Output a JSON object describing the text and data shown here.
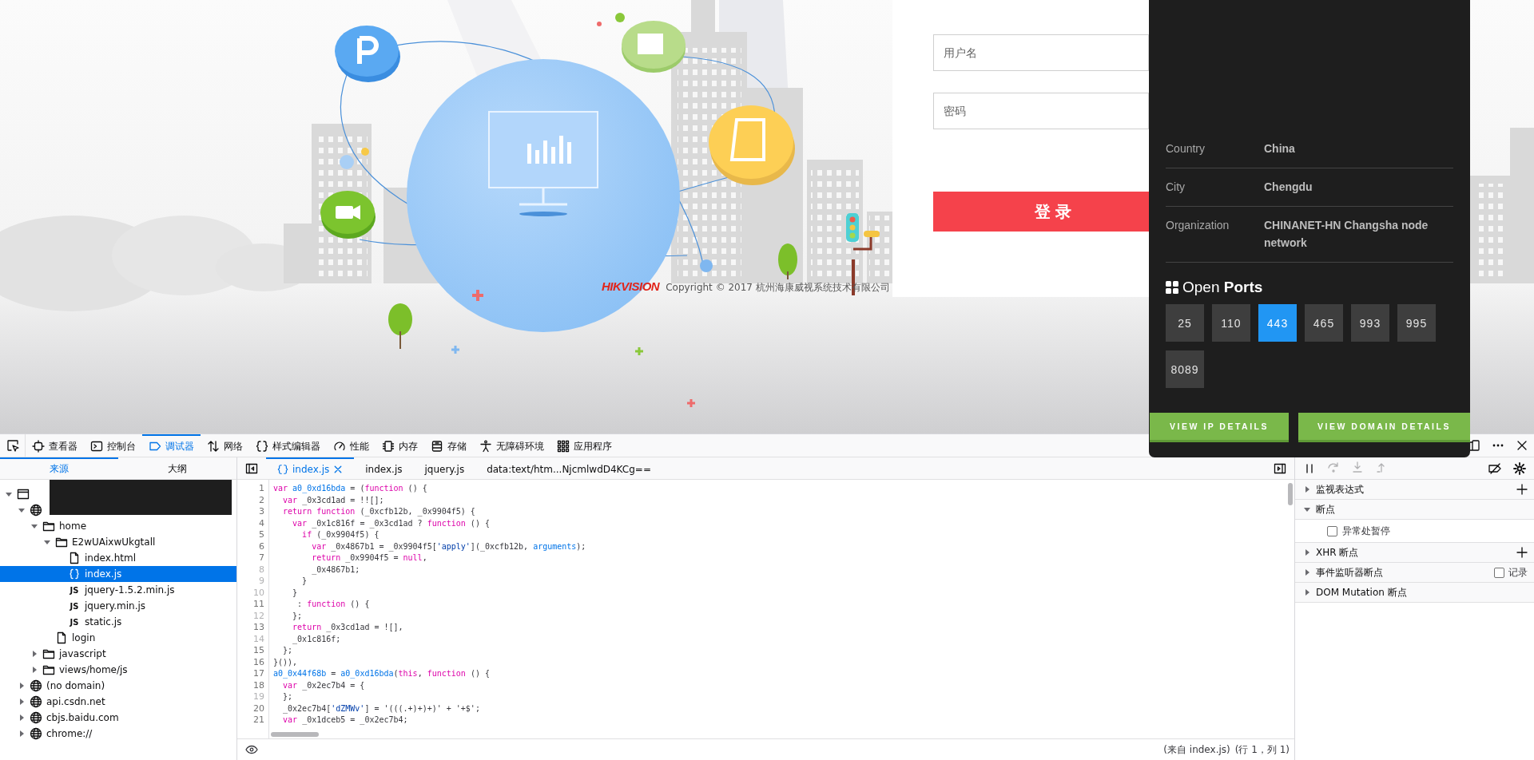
{
  "web_page": {
    "logo": "HIKVISION",
    "copyright": "Copyright © 2017 杭州海康威视系统技术有限公司",
    "login": {
      "username": {
        "placeholder": "用户名"
      },
      "password": {
        "placeholder": "密码"
      },
      "button": "登 录"
    }
  },
  "ip_popup": {
    "details": [
      {
        "label": "Country",
        "value": "China"
      },
      {
        "label": "City",
        "value": "Chengdu"
      },
      {
        "label": "Organization",
        "value": "CHINANET-HN Changsha node network"
      }
    ],
    "ports_title": "Open **Ports**",
    "ports": [
      {
        "label": "25",
        "selected": false
      },
      {
        "label": "110",
        "selected": false
      },
      {
        "label": "443",
        "selected": true
      },
      {
        "label": "465",
        "selected": false
      },
      {
        "label": "993",
        "selected": false
      },
      {
        "label": "995",
        "selected": false
      },
      {
        "label": "8089",
        "selected": false
      }
    ],
    "buttons": [
      "VIEW IP DETAILS",
      "VIEW DOMAIN DETAILS"
    ]
  },
  "devtools": {
    "tabs": [
      {
        "label": "查看器",
        "selected": false
      },
      {
        "label": "控制台",
        "selected": false
      },
      {
        "label": "调试器",
        "selected": true
      },
      {
        "label": "网络",
        "selected": false
      },
      {
        "label": "样式编辑器",
        "selected": false
      },
      {
        "label": "性能",
        "selected": false
      },
      {
        "label": "内存",
        "selected": false
      },
      {
        "label": "存储",
        "selected": false
      },
      {
        "label": "无障碍环境",
        "selected": false
      },
      {
        "label": "应用程序",
        "selected": false
      }
    ],
    "source_tabs": [
      {
        "label": "来源",
        "selected": true
      },
      {
        "label": "大纲",
        "selected": false
      }
    ],
    "tree": [
      {
        "kind": "window",
        "expanded": true,
        "selected": false,
        "children": [
          {
            "kind": "globe",
            "expanded": true,
            "selected": false,
            "children": [
              {
                "kind": "folder",
                "label": "home",
                "expanded": true,
                "selected": false,
                "children": [
                  {
                    "kind": "folder",
                    "label": "E2wUAixwUkgtall",
                    "expanded": true,
                    "selected": false,
                    "children": [
                      {
                        "kind": "file",
                        "label": "index.html",
                        "selected": false
                      },
                      {
                        "kind": "braces",
                        "label": "index.js",
                        "selected": true
                      },
                      {
                        "kind": "js",
                        "badge": "JS",
                        "label": "jquery-1.5.2.min.js",
                        "selected": false
                      },
                      {
                        "kind": "js",
                        "badge": "JS",
                        "label": "jquery.min.js",
                        "selected": false
                      },
                      {
                        "kind": "js",
                        "badge": "JS",
                        "label": "static.js",
                        "selected": false
                      }
                    ]
                  },
                  {
                    "kind": "file",
                    "label": "login",
                    "selected": false
                  }
                ]
              },
              {
                "kind": "folder",
                "label": "javascript",
                "expanded": false,
                "selected": false
              },
              {
                "kind": "folder",
                "label": "views/home/js",
                "expanded": false,
                "selected": false
              }
            ]
          },
          {
            "kind": "globe",
            "label": "(no domain)",
            "expanded": false,
            "selected": false
          },
          {
            "kind": "globe",
            "label": "api.csdn.net",
            "expanded": false,
            "selected": false
          },
          {
            "kind": "globe",
            "label": "cbjs.baidu.com",
            "expanded": false,
            "selected": false
          },
          {
            "kind": "globe",
            "label": "chrome://",
            "expanded": false,
            "selected": false
          }
        ]
      }
    ],
    "editor_tabs": [
      {
        "label": "index.js",
        "selected": true,
        "closable": true
      },
      {
        "label": "index.js",
        "selected": false,
        "closable": false
      },
      {
        "label": "jquery.js",
        "selected": false,
        "closable": false
      },
      {
        "label": "data:text/htm...NjcmlwdD4KCg==",
        "selected": false,
        "closable": false
      }
    ],
    "code_lines": [
      {
        "number": "1",
        "breakable": true,
        "tokens": [
          {
            "kind": "kw",
            "text": "var "
          },
          {
            "kind": "def",
            "text": "a0_0xd16bda"
          },
          {
            "kind": "plain",
            "text": " = ("
          },
          {
            "kind": "kw",
            "text": "function"
          },
          {
            "kind": "plain",
            "text": " () {"
          }
        ]
      },
      {
        "number": "2",
        "breakable": true,
        "tokens": [
          {
            "kind": "kw",
            "text": "  var "
          },
          {
            "kind": "plain",
            "text": "_0x3cd1ad = !![];"
          }
        ]
      },
      {
        "number": "3",
        "breakable": true,
        "tokens": [
          {
            "kind": "kw",
            "text": "  return function "
          },
          {
            "kind": "plain",
            "text": "(_0xcfb12b, _0x9904f5) {"
          }
        ]
      },
      {
        "number": "4",
        "breakable": true,
        "tokens": [
          {
            "kind": "kw",
            "text": "    var "
          },
          {
            "kind": "plain",
            "text": "_0x1c816f = _0x3cd1ad ? "
          },
          {
            "kind": "kw",
            "text": "function"
          },
          {
            "kind": "plain",
            "text": " () {"
          }
        ]
      },
      {
        "number": "5",
        "breakable": true,
        "tokens": [
          {
            "kind": "kw",
            "text": "      if "
          },
          {
            "kind": "plain",
            "text": "(_0x9904f5) {"
          }
        ]
      },
      {
        "number": "6",
        "breakable": true,
        "tokens": [
          {
            "kind": "kw",
            "text": "        var "
          },
          {
            "kind": "plain",
            "text": "_0x4867b1 = _0x9904f5["
          },
          {
            "kind": "str",
            "text": "'apply'"
          },
          {
            "kind": "plain",
            "text": "](_0xcfb12b, "
          },
          {
            "kind": "def",
            "text": "arguments"
          },
          {
            "kind": "plain",
            "text": ");"
          }
        ]
      },
      {
        "number": "7",
        "breakable": true,
        "tokens": [
          {
            "kind": "kw",
            "text": "        return "
          },
          {
            "kind": "plain",
            "text": "_0x9904f5 = "
          },
          {
            "kind": "kw",
            "text": "null"
          },
          {
            "kind": "plain",
            "text": ","
          }
        ]
      },
      {
        "number": "8",
        "breakable": false,
        "tokens": [
          {
            "kind": "plain",
            "text": "        _0x4867b1;"
          }
        ]
      },
      {
        "number": "9",
        "breakable": false,
        "tokens": [
          {
            "kind": "plain",
            "text": "      }"
          }
        ]
      },
      {
        "number": "10",
        "breakable": false,
        "tokens": [
          {
            "kind": "plain",
            "text": "    }"
          }
        ]
      },
      {
        "number": "11",
        "breakable": true,
        "tokens": [
          {
            "kind": "plain",
            "text": "     : "
          },
          {
            "kind": "kw",
            "text": "function"
          },
          {
            "kind": "plain",
            "text": " () {"
          }
        ]
      },
      {
        "number": "12",
        "breakable": false,
        "tokens": [
          {
            "kind": "plain",
            "text": "    };"
          }
        ]
      },
      {
        "number": "13",
        "breakable": true,
        "tokens": [
          {
            "kind": "kw",
            "text": "    return "
          },
          {
            "kind": "plain",
            "text": "_0x3cd1ad = ![],"
          }
        ]
      },
      {
        "number": "14",
        "breakable": false,
        "tokens": [
          {
            "kind": "plain",
            "text": "    _0x1c816f;"
          }
        ]
      },
      {
        "number": "15",
        "breakable": true,
        "tokens": [
          {
            "kind": "plain",
            "text": "  };"
          }
        ]
      },
      {
        "number": "16",
        "breakable": true,
        "tokens": [
          {
            "kind": "plain",
            "text": "}()),"
          }
        ]
      },
      {
        "number": "17",
        "breakable": true,
        "tokens": [
          {
            "kind": "def",
            "text": "a0_0x44f68b"
          },
          {
            "kind": "plain",
            "text": " = "
          },
          {
            "kind": "def",
            "text": "a0_0xd16bda"
          },
          {
            "kind": "plain",
            "text": "("
          },
          {
            "kind": "kw",
            "text": "this"
          },
          {
            "kind": "plain",
            "text": ", "
          },
          {
            "kind": "kw",
            "text": "function"
          },
          {
            "kind": "plain",
            "text": " () {"
          }
        ]
      },
      {
        "number": "18",
        "breakable": true,
        "tokens": [
          {
            "kind": "kw",
            "text": "  var "
          },
          {
            "kind": "plain",
            "text": "_0x2ec7b4 = {"
          }
        ]
      },
      {
        "number": "19",
        "breakable": false,
        "tokens": [
          {
            "kind": "plain",
            "text": "  };"
          }
        ]
      },
      {
        "number": "20",
        "breakable": true,
        "tokens": [
          {
            "kind": "plain",
            "text": "  _0x2ec7b4["
          },
          {
            "kind": "str",
            "text": "'dZMWv'"
          },
          {
            "kind": "plain",
            "text": "] = '(((.+)+)+)' + '+$';"
          }
        ]
      },
      {
        "number": "21",
        "breakable": true,
        "tokens": [
          {
            "kind": "kw",
            "text": "  var "
          },
          {
            "kind": "plain",
            "text": "_0x1dceb5 = _0x2ec7b4;"
          }
        ]
      }
    ],
    "sidebar_sections": [
      {
        "title": "监视表达式",
        "kind": "add",
        "expanded": false
      },
      {
        "title": "断点",
        "kind": "plain",
        "expanded": true,
        "options": [
          {
            "label": "异常处暂停",
            "checked": false
          }
        ]
      },
      {
        "title": "XHR 断点",
        "kind": "add",
        "expanded": false
      },
      {
        "title": "事件监听器断点",
        "kind": "toggle",
        "expanded": false,
        "toggle": {
          "label": "记录",
          "checked": false
        }
      },
      {
        "title": "DOM Mutation 断点",
        "kind": "plain",
        "expanded": false
      }
    ],
    "status_bar": {
      "source": "(来自 index.js)",
      "position": "(行 1，列 1)"
    }
  }
}
